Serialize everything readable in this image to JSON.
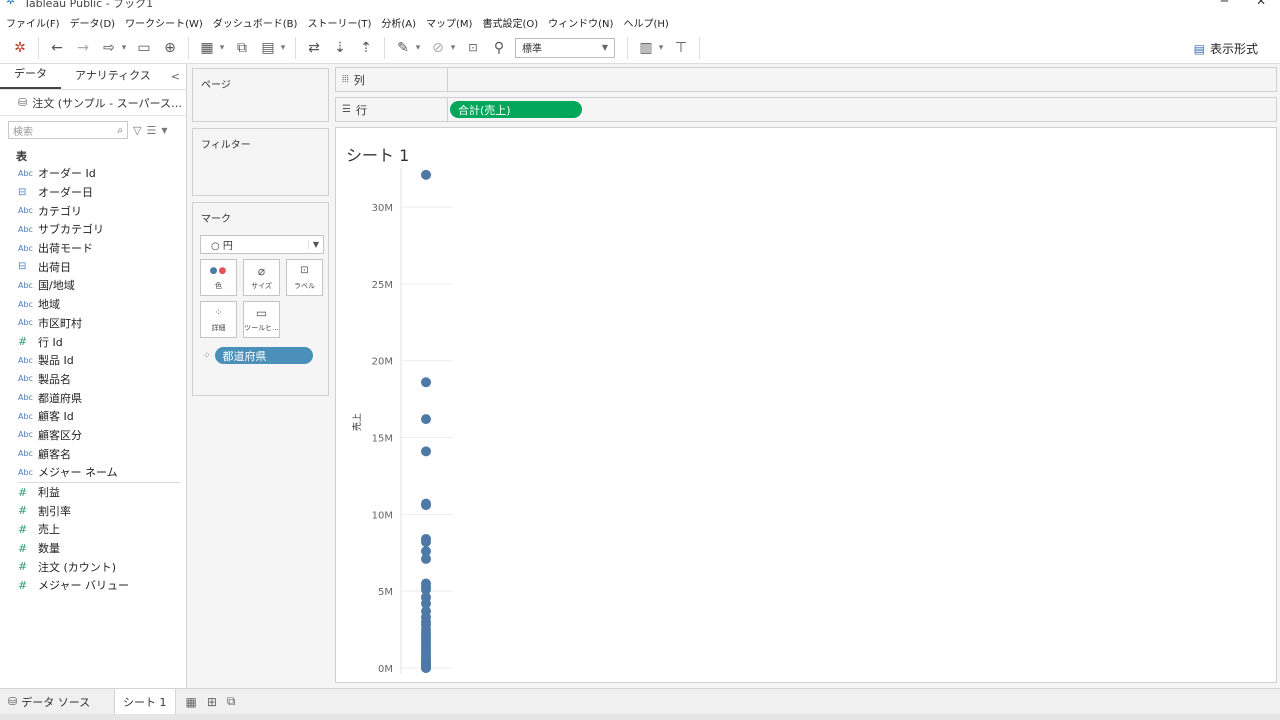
{
  "window": {
    "title": "Tableau Public - ブック1",
    "min_glyph": "─",
    "close_glyph": "✕"
  },
  "menu": [
    "ファイル(F)",
    "データ(D)",
    "ワークシート(W)",
    "ダッシュボード(B)",
    "ストーリー(T)",
    "分析(A)",
    "マップ(M)",
    "書式設定(O)",
    "ウィンドウ(N)",
    "ヘルプ(H)"
  ],
  "toolbar": {
    "fit_value": "標準",
    "show_me_label": "表示形式",
    "icons": [
      "tableau-logo-icon",
      "back-icon",
      "forward-icon",
      "redo-icon",
      "save-icon",
      "new-datasource-icon",
      "new-worksheet-icon",
      "duplicate-icon",
      "clear-sheet-icon",
      "swap-icon",
      "sort-ascending-icon",
      "sort-descending-icon",
      "highlight-icon",
      "group-icon",
      "label-icon",
      "pin-icon",
      "fit-icon",
      "presentation-icon"
    ]
  },
  "data_pane": {
    "tab_data": "データ",
    "tab_analytics": "アナリティクス",
    "collapse_glyph": "<",
    "datasource_name": "注文 (サンプル - スーパース…",
    "search_placeholder": "検索",
    "tables_header": "表",
    "dimensions": [
      {
        "type": "Abc",
        "name": "オーダー Id"
      },
      {
        "type": "date",
        "name": "オーダー日"
      },
      {
        "type": "Abc",
        "name": "カテゴリ"
      },
      {
        "type": "Abc",
        "name": "サブカテゴリ"
      },
      {
        "type": "Abc",
        "name": "出荷モード"
      },
      {
        "type": "date",
        "name": "出荷日"
      },
      {
        "type": "Abc",
        "name": "国/地域"
      },
      {
        "type": "Abc",
        "name": "地域"
      },
      {
        "type": "Abc",
        "name": "市区町村"
      },
      {
        "type": "#",
        "name": "行 Id"
      },
      {
        "type": "Abc",
        "name": "製品 Id"
      },
      {
        "type": "Abc",
        "name": "製品名"
      },
      {
        "type": "Abc",
        "name": "都道府県"
      },
      {
        "type": "Abc",
        "name": "顧客 Id"
      },
      {
        "type": "Abc",
        "name": "顧客区分"
      },
      {
        "type": "Abc",
        "name": "顧客名"
      },
      {
        "type": "Abc",
        "name": "メジャー ネーム"
      }
    ],
    "measures": [
      {
        "type": "#",
        "name": "利益"
      },
      {
        "type": "#",
        "name": "割引率"
      },
      {
        "type": "#",
        "name": "売上"
      },
      {
        "type": "#",
        "name": "数量"
      },
      {
        "type": "#",
        "name": "注文 (カウント)"
      },
      {
        "type": "#",
        "name": "メジャー バリュー"
      }
    ]
  },
  "cards": {
    "pages_title": "ページ",
    "filters_title": "フィルター",
    "marks_title": "マーク",
    "mark_type": "○ 円",
    "mark_buttons": [
      {
        "icon": "color-icon",
        "label": "色"
      },
      {
        "icon": "size-icon",
        "label": "サイズ"
      },
      {
        "icon": "label-icon",
        "label": "ラベル"
      },
      {
        "icon": "detail-icon",
        "label": "詳細"
      },
      {
        "icon": "tooltip-icon",
        "label": "ツールヒ..."
      }
    ],
    "detail_pill": "都道府県"
  },
  "shelves": {
    "columns_label": "列",
    "rows_label": "行",
    "rows_pill": "合計(売上)"
  },
  "view": {
    "sheet_title": "シート 1"
  },
  "bottom": {
    "datasource_tab": "データ ソース",
    "sheet_tab": "シート 1"
  },
  "colors": {
    "mark": "#4e79a7",
    "measure_pill": "#00a65a",
    "dimension_pill": "#4a90b8"
  },
  "chart_data": {
    "type": "scatter",
    "title": "シート 1",
    "ylabel": "売上",
    "xlabel": "",
    "y_ticks": [
      "0M",
      "5M",
      "10M",
      "15M",
      "20M",
      "25M",
      "30M"
    ],
    "ylim": [
      0,
      33000000
    ],
    "grid": false,
    "y": [
      32100000,
      18600000,
      16200000,
      14100000,
      10700000,
      10600000,
      8400000,
      8200000,
      7600000,
      7100000,
      5500000,
      5300000,
      5100000,
      4600000,
      4200000,
      3700000,
      3300000,
      3000000,
      2800000,
      2500000,
      2300000,
      2100000,
      1900000,
      1700000,
      1500000,
      1300000,
      1100000,
      950000,
      800000,
      650000,
      500000,
      420000,
      350000,
      280000,
      220000,
      170000,
      130000,
      100000,
      80000,
      60000,
      40000,
      30000,
      20000,
      15000,
      10000,
      8000,
      5000
    ]
  }
}
